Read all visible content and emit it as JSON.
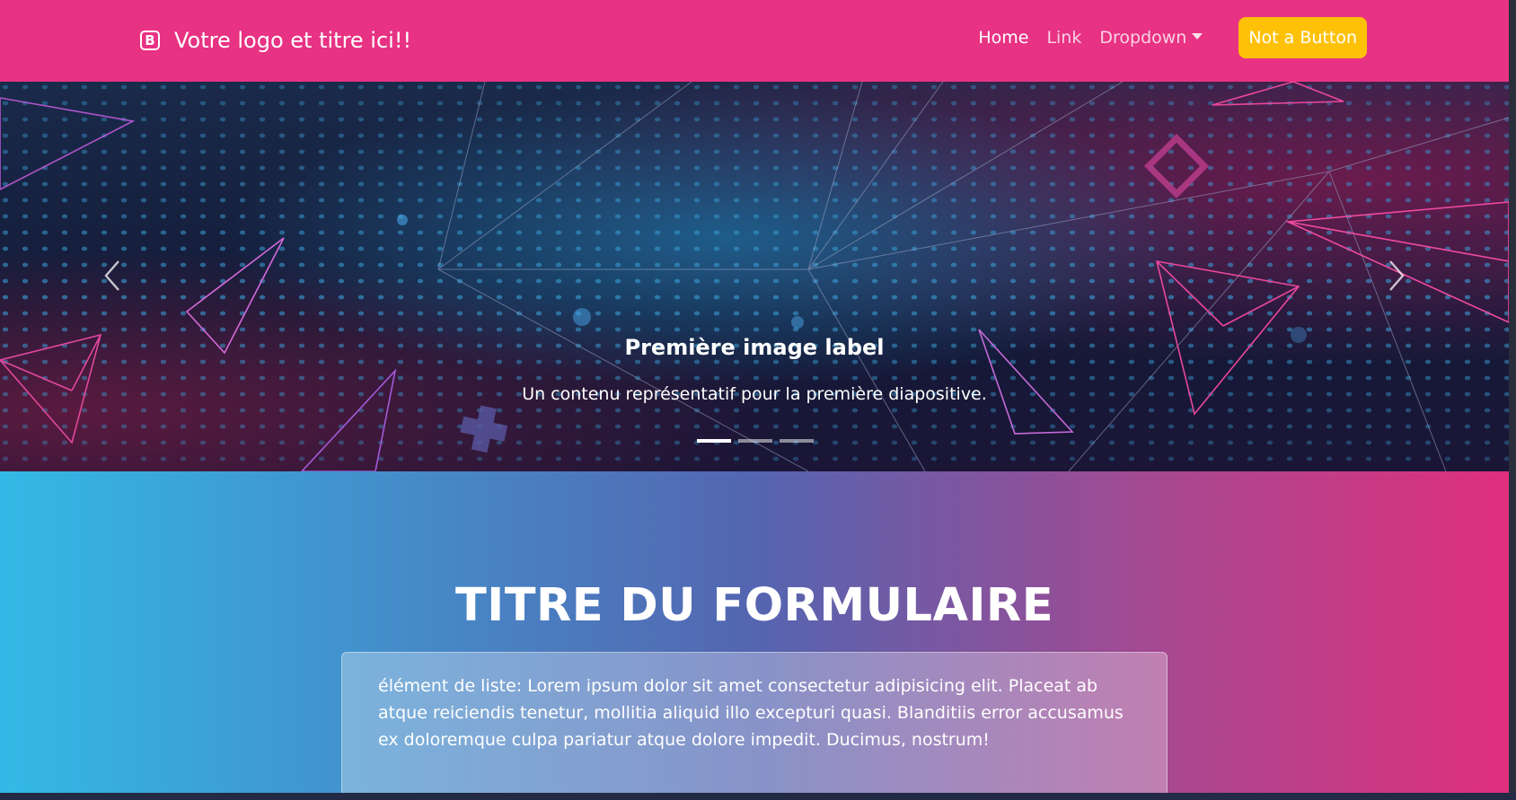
{
  "navbar": {
    "brand_icon_letter": "B",
    "brand_title": "Votre logo et titre ici!!",
    "links": [
      "Home",
      "Link",
      "Dropdown"
    ],
    "cta_label": "Not a Button"
  },
  "carousel": {
    "caption_title": "Première image label",
    "caption_text": "Un contenu représentatif pour la première diapositive.",
    "slide_count": 3,
    "active_slide": 1
  },
  "form_section": {
    "title": "TITRE DU FORMULAIRE",
    "card_text": "élément de liste: Lorem ipsum dolor sit amet consectetur adipisicing elit. Placeat ab atque reiciendis tenetur, mollitia aliquid illo excepturi quasi. Blanditiis error accusamus ex doloremque culpa pariatur atque dolore impedit. Ducimus, nostrum!"
  },
  "colors": {
    "navbar_bg": "#e83283",
    "cta_bg": "#ffc107",
    "gradient_start": "#33b9e5",
    "gradient_mid": "#5465b1",
    "gradient_end": "#df2f7d"
  }
}
